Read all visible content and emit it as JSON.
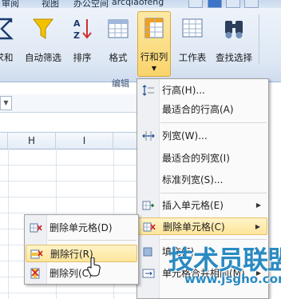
{
  "tabs": {
    "review": "审阅",
    "view": "视图",
    "office_club": "办公空间",
    "extra": "arcqiaofeng"
  },
  "ribbon": {
    "buttons": [
      {
        "label": "求和",
        "icon": "sum-icon"
      },
      {
        "label": "自动筛选",
        "icon": "filter-icon"
      },
      {
        "label": "排序",
        "icon": "sort-icon"
      },
      {
        "label": "格式",
        "icon": "format-icon"
      },
      {
        "label": "行和列",
        "icon": "rows-columns-icon",
        "active": true
      },
      {
        "label": "工作表",
        "icon": "worksheet-icon"
      },
      {
        "label": "查找选择",
        "icon": "find-select-icon"
      }
    ],
    "group_label": "编辑"
  },
  "sheet": {
    "columns": [
      "H",
      "I"
    ]
  },
  "rows_cols_menu": {
    "items": [
      {
        "label": "行高(H)...",
        "icon": "row-height-icon"
      },
      {
        "label": "最适合的行高(A)",
        "icon": ""
      },
      {
        "label": "列宽(W)...",
        "icon": "column-width-icon"
      },
      {
        "label": "最适合的列宽(I)",
        "icon": ""
      },
      {
        "label": "标准列宽(S)...",
        "icon": ""
      },
      {
        "label": "插入单元格(E)",
        "icon": "insert-cells-icon",
        "submenu": true
      },
      {
        "label": "删除单元格(C)",
        "icon": "delete-cells-icon",
        "submenu": true,
        "highlighted": true
      },
      {
        "label": "填充(F)",
        "icon": "fill-icon",
        "submenu": true
      },
      {
        "label": "单元格合并相同(M)",
        "icon": "merge-icon",
        "submenu": true
      }
    ]
  },
  "delete_submenu": {
    "items": [
      {
        "label": "删除单元格(D)",
        "icon": "delete-cell-icon"
      },
      {
        "label": "删除行(R)",
        "icon": "delete-row-icon",
        "highlighted": true
      },
      {
        "label": "删除列(C)",
        "icon": "delete-column-icon"
      }
    ]
  },
  "watermark": {
    "text": "技术员联盟",
    "url": "www.jsgho.com"
  },
  "colors": {
    "highlight": "#fde59a",
    "ribbon_bg": "#dde7f4",
    "accent_blue": "#2a8ac2"
  }
}
